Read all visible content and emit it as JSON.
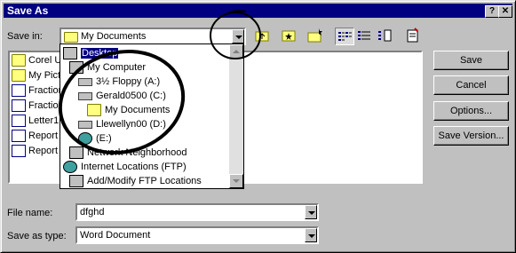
{
  "window": {
    "title": "Save As",
    "help_label": "?",
    "close_label": "✕"
  },
  "save_in": {
    "label": "Save in:",
    "value": "My Documents"
  },
  "toolbar": {
    "icons": [
      "up-one-level-icon",
      "search-web-icon",
      "create-new-folder-icon",
      "list-view-icon",
      "details-view-icon",
      "properties-view-icon",
      "commands-settings-icon"
    ]
  },
  "files": [
    {
      "name": "Corel U",
      "icon": "folder"
    },
    {
      "name": "My Pictu",
      "icon": "folder"
    },
    {
      "name": "Fraction",
      "icon": "doc"
    },
    {
      "name": "Fraction",
      "icon": "doc"
    },
    {
      "name": "Letter1",
      "icon": "doc"
    },
    {
      "name": "Report",
      "icon": "doc"
    },
    {
      "name": "Report",
      "icon": "doc"
    }
  ],
  "dropdown": {
    "items": [
      {
        "label": "Desktop",
        "icon": "desktop",
        "selected": true
      },
      {
        "label": "My Computer",
        "icon": "computer"
      },
      {
        "label": "3½ Floppy (A:)",
        "icon": "drive"
      },
      {
        "label": "Gerald0500 (C:)",
        "icon": "drive"
      },
      {
        "label": "My Documents",
        "icon": "folder"
      },
      {
        "label": "Llewellyn00 (D:)",
        "icon": "drive"
      },
      {
        "label": "(E:)",
        "icon": "cd"
      },
      {
        "label": "Network Neighborhood",
        "icon": "computer"
      },
      {
        "label": "Internet Locations (FTP)",
        "icon": "globe"
      },
      {
        "label": "Add/Modify FTP Locations",
        "icon": "computer"
      }
    ]
  },
  "buttons": {
    "save": "Save",
    "cancel": "Cancel",
    "options": "Options...",
    "save_version": "Save Version..."
  },
  "file_name": {
    "label": "File name:",
    "value": "dfghd"
  },
  "save_as_type": {
    "label": "Save as type:",
    "value": "Word Document"
  }
}
